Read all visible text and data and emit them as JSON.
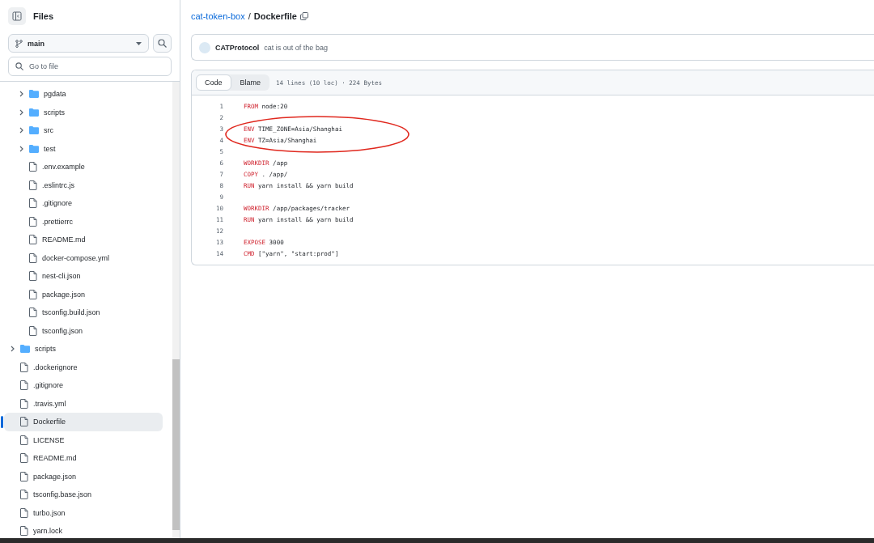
{
  "sidebar": {
    "title": "Files",
    "branch": "main",
    "search": {
      "placeholder": "Go to file"
    },
    "tree": [
      {
        "children": [
          {
            "name": "pgdata",
            "kind": "folder",
            "expanded": false,
            "selected": false
          },
          {
            "name": "scripts",
            "kind": "folder",
            "expanded": false,
            "selected": false
          },
          {
            "name": "src",
            "kind": "folder",
            "expanded": false,
            "selected": false
          },
          {
            "name": "test",
            "kind": "folder",
            "expanded": false,
            "selected": false
          },
          {
            "name": ".env.example",
            "kind": "file",
            "selected": false
          },
          {
            "name": ".eslintrc.js",
            "kind": "file",
            "selected": false
          },
          {
            "name": ".gitignore",
            "kind": "file",
            "selected": false
          },
          {
            "name": ".prettierrc",
            "kind": "file",
            "selected": false
          },
          {
            "name": "README.md",
            "kind": "file",
            "selected": false
          },
          {
            "name": "docker-compose.yml",
            "kind": "file",
            "selected": false
          },
          {
            "name": "nest-cli.json",
            "kind": "file",
            "selected": false
          },
          {
            "name": "package.json",
            "kind": "file",
            "selected": false
          },
          {
            "name": "tsconfig.build.json",
            "kind": "file",
            "selected": false
          },
          {
            "name": "tsconfig.json",
            "kind": "file",
            "selected": false
          }
        ]
      },
      {
        "name": "scripts",
        "kind": "folder",
        "expanded": false,
        "selected": false
      },
      {
        "name": ".dockerignore",
        "kind": "file",
        "selected": false
      },
      {
        "name": ".gitignore",
        "kind": "file",
        "selected": false
      },
      {
        "name": ".travis.yml",
        "kind": "file",
        "selected": false
      },
      {
        "name": "Dockerfile",
        "kind": "file",
        "selected": true
      },
      {
        "name": "LICENSE",
        "kind": "file",
        "selected": false
      },
      {
        "name": "README.md",
        "kind": "file",
        "selected": false
      },
      {
        "name": "package.json",
        "kind": "file",
        "selected": false
      },
      {
        "name": "tsconfig.base.json",
        "kind": "file",
        "selected": false
      },
      {
        "name": "turbo.json",
        "kind": "file",
        "selected": false
      },
      {
        "name": "yarn.lock",
        "kind": "file",
        "selected": false
      }
    ]
  },
  "breadcrumb": {
    "repo": "cat-token-box",
    "separator": "/",
    "file": "Dockerfile"
  },
  "commit": {
    "author": "CATProtocol",
    "message": "cat is out of the bag"
  },
  "file_view": {
    "tabs": [
      {
        "label": "Code",
        "selected": true
      },
      {
        "label": "Blame",
        "selected": false
      }
    ],
    "info": "14 lines (10 loc) · 224 Bytes",
    "lines": [
      {
        "number": "1",
        "keyword": "FROM",
        "rest": " node:20",
        "circled": false
      },
      {
        "number": "2",
        "circled": false
      },
      {
        "number": "3",
        "keyword": "ENV",
        "rest": " TIME_ZONE=Asia/Shanghai",
        "circled": true
      },
      {
        "number": "4",
        "keyword": "ENV",
        "rest": " TZ=Asia/Shanghai",
        "circled": true
      },
      {
        "number": "5",
        "circled": false
      },
      {
        "number": "6",
        "keyword": "WORKDIR",
        "rest": " /app",
        "circled": false
      },
      {
        "number": "7",
        "keyword": "COPY",
        "rest": " . /app/",
        "circled": false
      },
      {
        "number": "8",
        "keyword": "RUN",
        "rest": " yarn install && yarn build",
        "circled": false
      },
      {
        "number": "9",
        "circled": false
      },
      {
        "number": "10",
        "keyword": "WORKDIR",
        "rest": " /app/packages/tracker",
        "circled": false
      },
      {
        "number": "11",
        "keyword": "RUN",
        "rest": " yarn install && yarn build",
        "circled": false
      },
      {
        "number": "12",
        "circled": false
      },
      {
        "number": "13",
        "keyword": "EXPOSE",
        "rest": " 3000",
        "circled": false
      },
      {
        "number": "14",
        "keyword": "CMD",
        "rest": " [\"yarn\", \"start:prod\"]",
        "circled": false
      }
    ]
  }
}
